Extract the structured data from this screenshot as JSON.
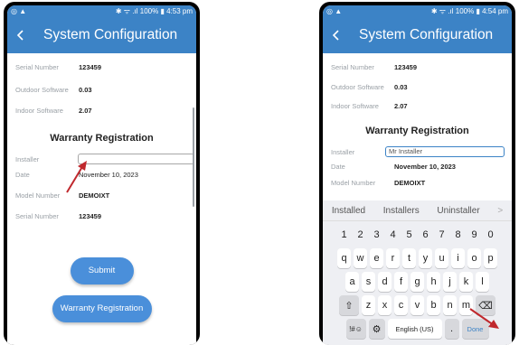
{
  "left": {
    "status": {
      "left": "◎ ▲",
      "right": "✱ ᯤ .ıl 100% ▮ 4:53 pm"
    },
    "appbar": {
      "title": "System Configuration"
    },
    "info": [
      {
        "label": "Serial Number",
        "value": "123459"
      },
      {
        "label": "Outdoor Software",
        "value": "0.03"
      },
      {
        "label": "Indoor Software",
        "value": "2.07"
      }
    ],
    "section_title": "Warranty Registration",
    "form": {
      "installer_label": "Installer",
      "installer_value": "",
      "date_label": "Date",
      "date_value": "November 10, 2023",
      "model_label": "Model Number",
      "model_value": "DEMOIXT",
      "serial_label": "Serial Number",
      "serial_value": "123459"
    },
    "buttons": {
      "submit": "Submit",
      "warranty": "Warranty Registration"
    }
  },
  "right": {
    "status": {
      "left": "◎ ▲",
      "right": "✱ ᯤ .ıl 100% ▮ 4:54 pm"
    },
    "appbar": {
      "title": "System Configuration"
    },
    "info": [
      {
        "label": "Serial Number",
        "value": "123459"
      },
      {
        "label": "Outdoor Software",
        "value": "0.03"
      },
      {
        "label": "Indoor Software",
        "value": "2.07"
      }
    ],
    "section_title": "Warranty Registration",
    "form": {
      "installer_label": "Installer",
      "installer_value": "Mr Installer",
      "date_label": "Date",
      "date_value": "November 10, 2023",
      "model_label": "Model Number",
      "model_value": "DEMOIXT"
    },
    "keyboard": {
      "suggestions": [
        "Installed",
        "Installers",
        "Uninstaller"
      ],
      "numbers": [
        "1",
        "2",
        "3",
        "4",
        "5",
        "6",
        "7",
        "8",
        "9",
        "0"
      ],
      "row1": [
        "q",
        "w",
        "e",
        "r",
        "t",
        "y",
        "u",
        "i",
        "o",
        "p"
      ],
      "row2": [
        "a",
        "s",
        "d",
        "f",
        "g",
        "h",
        "j",
        "k",
        "l"
      ],
      "row3": [
        "z",
        "x",
        "c",
        "v",
        "b",
        "n",
        "m"
      ],
      "shift_glyph": "⇧",
      "backspace_glyph": "⌫",
      "symbols": "!#☺",
      "settings_glyph": "⚙",
      "space": "English (US)",
      "period": ".",
      "done": "Done",
      "more_glyph": ">"
    }
  },
  "colors": {
    "appbar": "#3c83c6",
    "button": "#4a8fda",
    "arrow": "#c0282d",
    "input_focus": "#3c83c6"
  }
}
